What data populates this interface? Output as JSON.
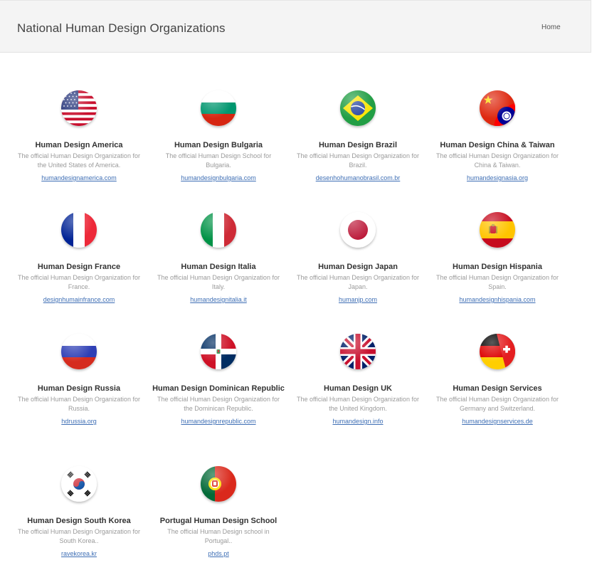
{
  "header": {
    "title": "National Human Design Organizations",
    "home_label": "Home"
  },
  "orgs": [
    {
      "title": "Human Design America",
      "desc": "The official Human Design Organization for the United States of America.",
      "link": "humandesignamerica.com",
      "flag": "usa-flag-icon"
    },
    {
      "title": "Human Design Bulgaria",
      "desc": "The official Human Design School for Bulgaria.",
      "link": "humandesignbulgaria.com",
      "flag": "bulgaria-flag-icon"
    },
    {
      "title": "Human Design Brazil",
      "desc": "The official Human Design Organization for Brazil.",
      "link": "desenhohumanobrasil.com.br",
      "flag": "brazil-flag-icon"
    },
    {
      "title": "Human Design China & Taiwan",
      "desc": "The official Human Design Organization for China & Taiwan.",
      "link": "humandesignasia.org",
      "flag": "china-taiwan-flag-icon"
    },
    {
      "title": "Human Design France",
      "desc": "The official Human Design Organization for France.",
      "link": "designhumainfrance.com",
      "flag": "france-flag-icon"
    },
    {
      "title": "Human Design Italia",
      "desc": "The official Human Design Organization for Italy.",
      "link": "humandesignitalia.it",
      "flag": "italy-flag-icon"
    },
    {
      "title": "Human Design Japan",
      "desc": "The official Human Design Organization for Japan.",
      "link": "humanjp.com",
      "flag": "japan-flag-icon"
    },
    {
      "title": "Human Design Hispania",
      "desc": "The official Human Design Organization for Spain.",
      "link": "humandesignhispania.com",
      "flag": "spain-flag-icon"
    },
    {
      "title": "Human Design Russia",
      "desc": "The official Human Design Organization for Russia.",
      "link": "hdrussia.org",
      "flag": "russia-flag-icon"
    },
    {
      "title": "Human Design Dominican Republic",
      "desc": "The official Human Design Organization for the Dominican Republic.",
      "link": "humandesignrepublic.com",
      "flag": "dominican-republic-flag-icon"
    },
    {
      "title": "Human Design UK",
      "desc": "The official Human Design Organization for the United Kingdom.",
      "link": "humandesign.info",
      "flag": "uk-flag-icon"
    },
    {
      "title": "Human Design Services",
      "desc": "The official Human Design Organization for Germany and Switzerland.",
      "link": "humandesignservices.de",
      "flag": "germany-switzerland-flag-icon"
    },
    {
      "title": "Human Design South Korea",
      "desc": "The official Human Design Organization for South Korea..",
      "link": "ravekorea.kr",
      "flag": "south-korea-flag-icon"
    },
    {
      "title": "Portugal Human Design School",
      "desc": "The official Human Design school in Portugal..",
      "link": "phds.pt",
      "flag": "portugal-flag-icon"
    }
  ]
}
